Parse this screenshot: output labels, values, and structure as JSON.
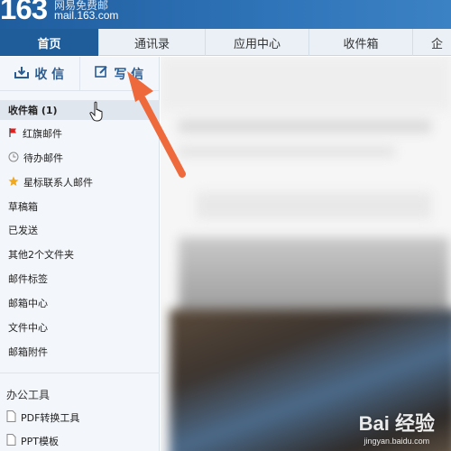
{
  "header": {
    "logo_number": "163",
    "logo_tagline": "网易免费邮",
    "logo_domain": "mail.163.com"
  },
  "nav": {
    "tabs": [
      {
        "label": "首页",
        "active": true
      },
      {
        "label": "通讯录",
        "active": false
      },
      {
        "label": "应用中心",
        "active": false
      },
      {
        "label": "收件箱",
        "active": false
      },
      {
        "label": "企",
        "active": false
      }
    ]
  },
  "compose": {
    "receive_label": "收 信",
    "write_label": "写 信"
  },
  "folders": [
    {
      "label": "收件箱 (1)",
      "icon": "",
      "selected": true
    },
    {
      "label": "红旗邮件",
      "icon": "red-flag-icon",
      "selected": false
    },
    {
      "label": "待办邮件",
      "icon": "clock-icon",
      "selected": false
    },
    {
      "label": "星标联系人邮件",
      "icon": "star-icon",
      "selected": false
    },
    {
      "label": "草稿箱",
      "icon": "",
      "selected": false
    },
    {
      "label": "已发送",
      "icon": "",
      "selected": false
    },
    {
      "label": "其他2个文件夹",
      "icon": "",
      "selected": false
    },
    {
      "label": "邮件标签",
      "icon": "",
      "selected": false
    },
    {
      "label": "邮箱中心",
      "icon": "",
      "selected": false
    },
    {
      "label": "文件中心",
      "icon": "",
      "selected": false
    },
    {
      "label": "邮箱附件",
      "icon": "",
      "selected": false
    }
  ],
  "tools": {
    "heading": "办公工具",
    "items": [
      {
        "label": "PDF转换工具",
        "icon": "document-icon"
      },
      {
        "label": "PPT模板",
        "icon": "document-icon"
      }
    ]
  },
  "watermark": {
    "main": "Bai 经验",
    "sub": "jingyan.baidu.com"
  },
  "colors": {
    "header_blue": "#2f74b8",
    "active_tab": "#1e5c9a",
    "arrow": "#ee6a3c"
  }
}
